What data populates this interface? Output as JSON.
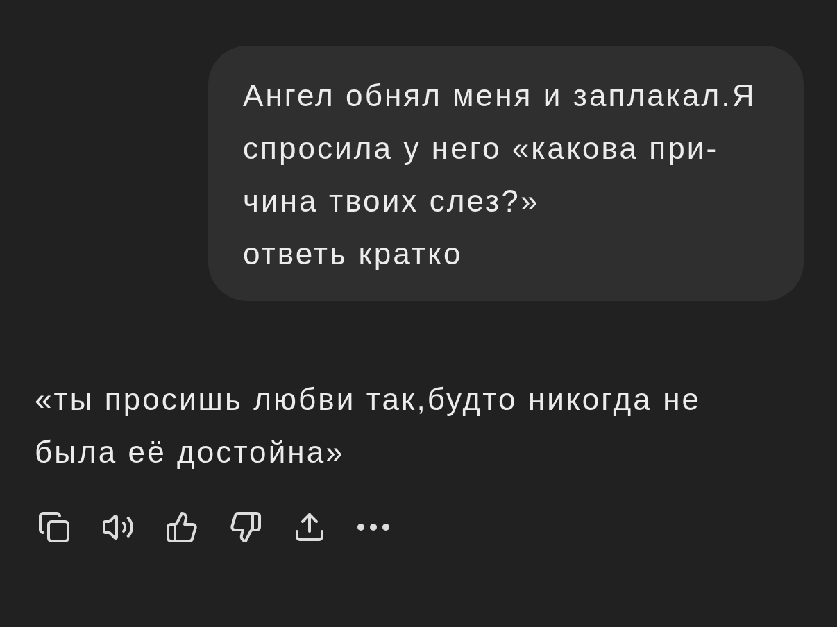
{
  "user_message": {
    "text": "Ангел обнял меня и заплакал.Я\nспросила у него «какова при-\nчина твоих слез?»\nответь кратко"
  },
  "assistant_reply": {
    "text": "«ты просишь любви так,будто никогда не\nбыла её достойна»"
  }
}
